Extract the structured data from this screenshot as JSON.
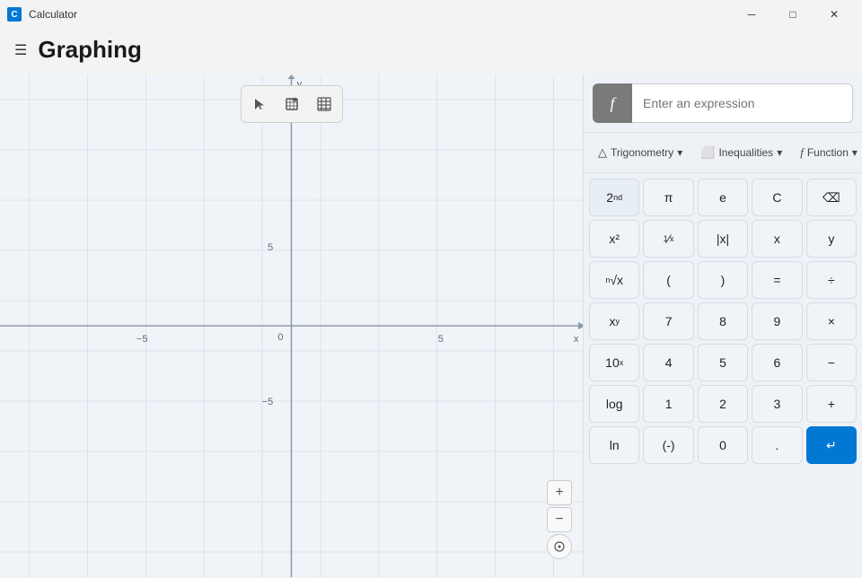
{
  "titleBar": {
    "icon": "C",
    "title": "Calculator",
    "minBtn": "─",
    "maxBtn": "□",
    "closeBtn": "✕"
  },
  "header": {
    "title": "Graphing",
    "menuIcon": "☰"
  },
  "graphToolbar": {
    "selectBtn": "▷",
    "shareBtn": "⬚",
    "tableBtn": "⊞"
  },
  "exprInput": {
    "fLabel": "f",
    "placeholder": "Enter an expression"
  },
  "tabs": [
    {
      "id": "trigonometry",
      "icon": "△",
      "label": "Trigonometry",
      "hasDropdown": true
    },
    {
      "id": "inequalities",
      "icon": "⬜",
      "label": "Inequalities",
      "hasDropdown": true
    },
    {
      "id": "function",
      "icon": "f",
      "label": "Function",
      "hasDropdown": true
    }
  ],
  "keypad": {
    "rows": [
      [
        {
          "label": "2ⁿᵈ",
          "id": "2nd",
          "style": "dark"
        },
        {
          "label": "π",
          "id": "pi"
        },
        {
          "label": "e",
          "id": "e"
        },
        {
          "label": "C",
          "id": "clear"
        },
        {
          "label": "⌫",
          "id": "backspace"
        }
      ],
      [
        {
          "label": "x²",
          "id": "x-squared"
        },
        {
          "label": "¹⁄ₓ",
          "id": "reciprocal"
        },
        {
          "label": "|x|",
          "id": "abs"
        },
        {
          "label": "x",
          "id": "x"
        },
        {
          "label": "y",
          "id": "y"
        }
      ],
      [
        {
          "label": "ⁿ√x",
          "id": "nth-root"
        },
        {
          "label": "(",
          "id": "open-paren"
        },
        {
          "label": ")",
          "id": "close-paren"
        },
        {
          "label": "=",
          "id": "equals"
        },
        {
          "label": "÷",
          "id": "divide"
        }
      ],
      [
        {
          "label": "xʸ",
          "id": "x-power-y"
        },
        {
          "label": "7",
          "id": "7"
        },
        {
          "label": "8",
          "id": "8"
        },
        {
          "label": "9",
          "id": "9"
        },
        {
          "label": "×",
          "id": "multiply"
        }
      ],
      [
        {
          "label": "10ˣ",
          "id": "10-power-x"
        },
        {
          "label": "4",
          "id": "4"
        },
        {
          "label": "5",
          "id": "5"
        },
        {
          "label": "6",
          "id": "6"
        },
        {
          "label": "−",
          "id": "subtract"
        }
      ],
      [
        {
          "label": "log",
          "id": "log"
        },
        {
          "label": "1",
          "id": "1"
        },
        {
          "label": "2",
          "id": "2"
        },
        {
          "label": "3",
          "id": "3"
        },
        {
          "label": "+",
          "id": "add"
        }
      ],
      [
        {
          "label": "ln",
          "id": "ln"
        },
        {
          "label": "(-)",
          "id": "negate"
        },
        {
          "label": "0",
          "id": "0"
        },
        {
          "label": ".",
          "id": "decimal"
        },
        {
          "label": "↵",
          "id": "enter",
          "style": "blue"
        }
      ]
    ]
  },
  "graph": {
    "xMin": -10,
    "xMax": 10,
    "yMin": -10,
    "yMax": 10,
    "labels": {
      "x": "x",
      "y": "y",
      "xPos5": "5",
      "xNeg5": "−5",
      "yPos5": "5",
      "yNeg5": "−5",
      "origin": "0"
    }
  },
  "zoom": {
    "plusLabel": "+",
    "minusLabel": "−",
    "centerLabel": "⊙"
  }
}
